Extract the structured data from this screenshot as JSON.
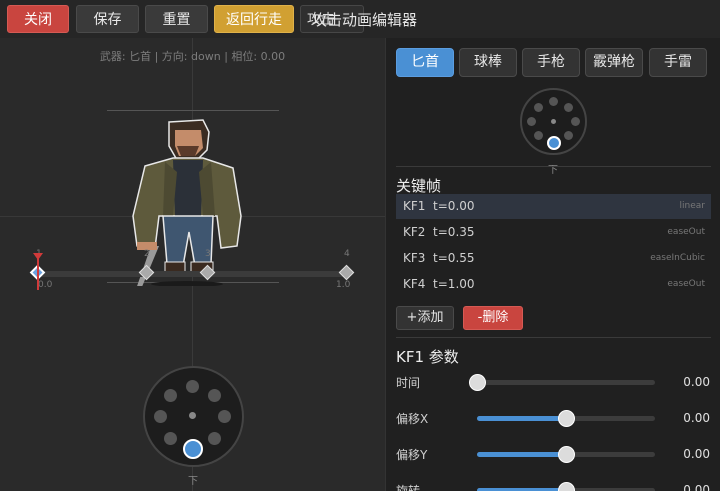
{
  "toolbar": {
    "close": "关闭",
    "save": "保存",
    "reset": "重置",
    "back": "返回行走",
    "toggle": "攻击",
    "title": "攻击动画编辑器"
  },
  "canvas": {
    "info": "武器: 匕首 | 方向: down | 相位: 0.00",
    "timeline": {
      "start": "0.0",
      "end": "1.0",
      "markers": [
        "1",
        "2",
        "3",
        "4"
      ],
      "keyframe_times": [
        0.0,
        0.35,
        0.55,
        1.0
      ],
      "playhead": 0.0
    },
    "direction_label": "下"
  },
  "weapons": {
    "tabs": [
      "匕首",
      "球棒",
      "手枪",
      "霰弹枪",
      "手雷"
    ],
    "active": "匕首",
    "direction_label": "下"
  },
  "keyframes": {
    "title": "关键帧",
    "items": [
      {
        "name": "KF1",
        "time": "t=0.00",
        "ease": "linear"
      },
      {
        "name": "KF2",
        "time": "t=0.35",
        "ease": "easeOut"
      },
      {
        "name": "KF3",
        "time": "t=0.55",
        "ease": "easeInCubic"
      },
      {
        "name": "KF4",
        "time": "t=1.00",
        "ease": "easeOut"
      }
    ],
    "add": "+添加",
    "delete": "-删除"
  },
  "params": {
    "title": "KF1 参数",
    "items": [
      {
        "label": "时间",
        "value": "0.00",
        "fraction": 0.0
      },
      {
        "label": "偏移X",
        "value": "0.00",
        "fraction": 0.5
      },
      {
        "label": "偏移Y",
        "value": "0.00",
        "fraction": 0.5
      },
      {
        "label": "旋转",
        "value": "0.00",
        "fraction": 0.5
      }
    ]
  },
  "colors": {
    "accent": "#4a90d4",
    "danger": "#c9453f",
    "gold": "#d1a032",
    "playhead": "#d03a3a"
  }
}
